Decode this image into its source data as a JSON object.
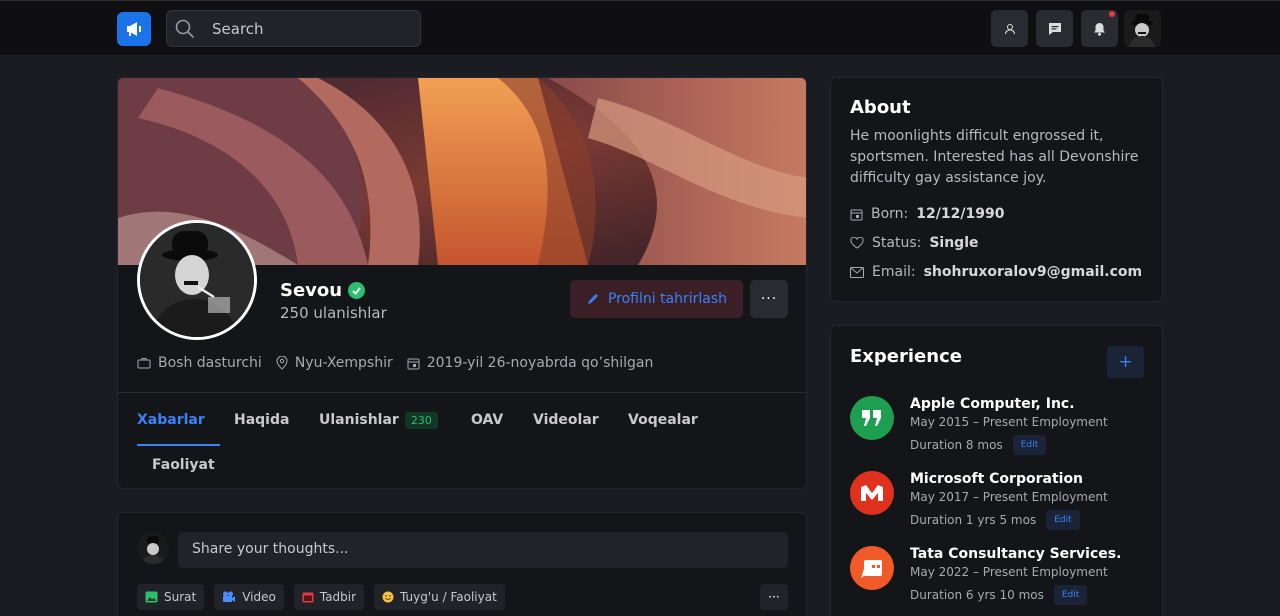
{
  "nav": {
    "search_placeholder": "Search",
    "icons": [
      "megaphone-icon",
      "search-icon",
      "user-icon",
      "chat-icon",
      "bell-icon"
    ],
    "accent": "#1a73e8"
  },
  "profile": {
    "name": "Sevou",
    "connections": "250 ulanishlar",
    "edit_button": "Profilni tahrirlash",
    "more": "···",
    "meta": {
      "job": "Bosh dasturchi",
      "location": "Nyu-Xempshir",
      "joined": "2019-yil 26-noyabrda qo’shilgan"
    },
    "tabs": {
      "posts": "Xabarlar",
      "about": "Haqida",
      "connections": "Ulanishlar",
      "connections_count": "230",
      "media": "OAV",
      "videos": "Videolar",
      "events": "Voqealar",
      "activity": "Faoliyat"
    }
  },
  "post": {
    "placeholder": "Share your thoughts...",
    "actions": {
      "photo": "Surat",
      "video": "Video",
      "event": "Tadbir",
      "feeling": "Tuyg'u / Faoliyat"
    },
    "more": "···"
  },
  "about": {
    "title": "About",
    "text": "He moonlights difficult engrossed it, sportsmen. Interested has all Devonshire difficulty gay assistance joy.",
    "born_label": "Born:",
    "born_value": "12/12/1990",
    "status_label": "Status:",
    "status_value": "Single",
    "email_label": "Email:",
    "email_value": "shohruxoralov9@gmail.com"
  },
  "experience": {
    "title": "Experience",
    "add": "+",
    "items": [
      {
        "company": "Apple Computer, Inc.",
        "period": "May 2015 – Present Employment",
        "duration": "Duration 8 mos",
        "edit": "Edit",
        "logo_color": "#1e9e4f"
      },
      {
        "company": "Microsoft Corporation",
        "period": "May 2017 – Present Employment",
        "duration": "Duration 1 yrs 5 mos",
        "edit": "Edit",
        "logo_color": "#e0301e"
      },
      {
        "company": "Tata Consultancy Services.",
        "period": "May 2022 – Present Employment",
        "duration": "Duration 6 yrs 10 mos",
        "edit": "Edit",
        "logo_color": "#f05a28"
      }
    ]
  }
}
